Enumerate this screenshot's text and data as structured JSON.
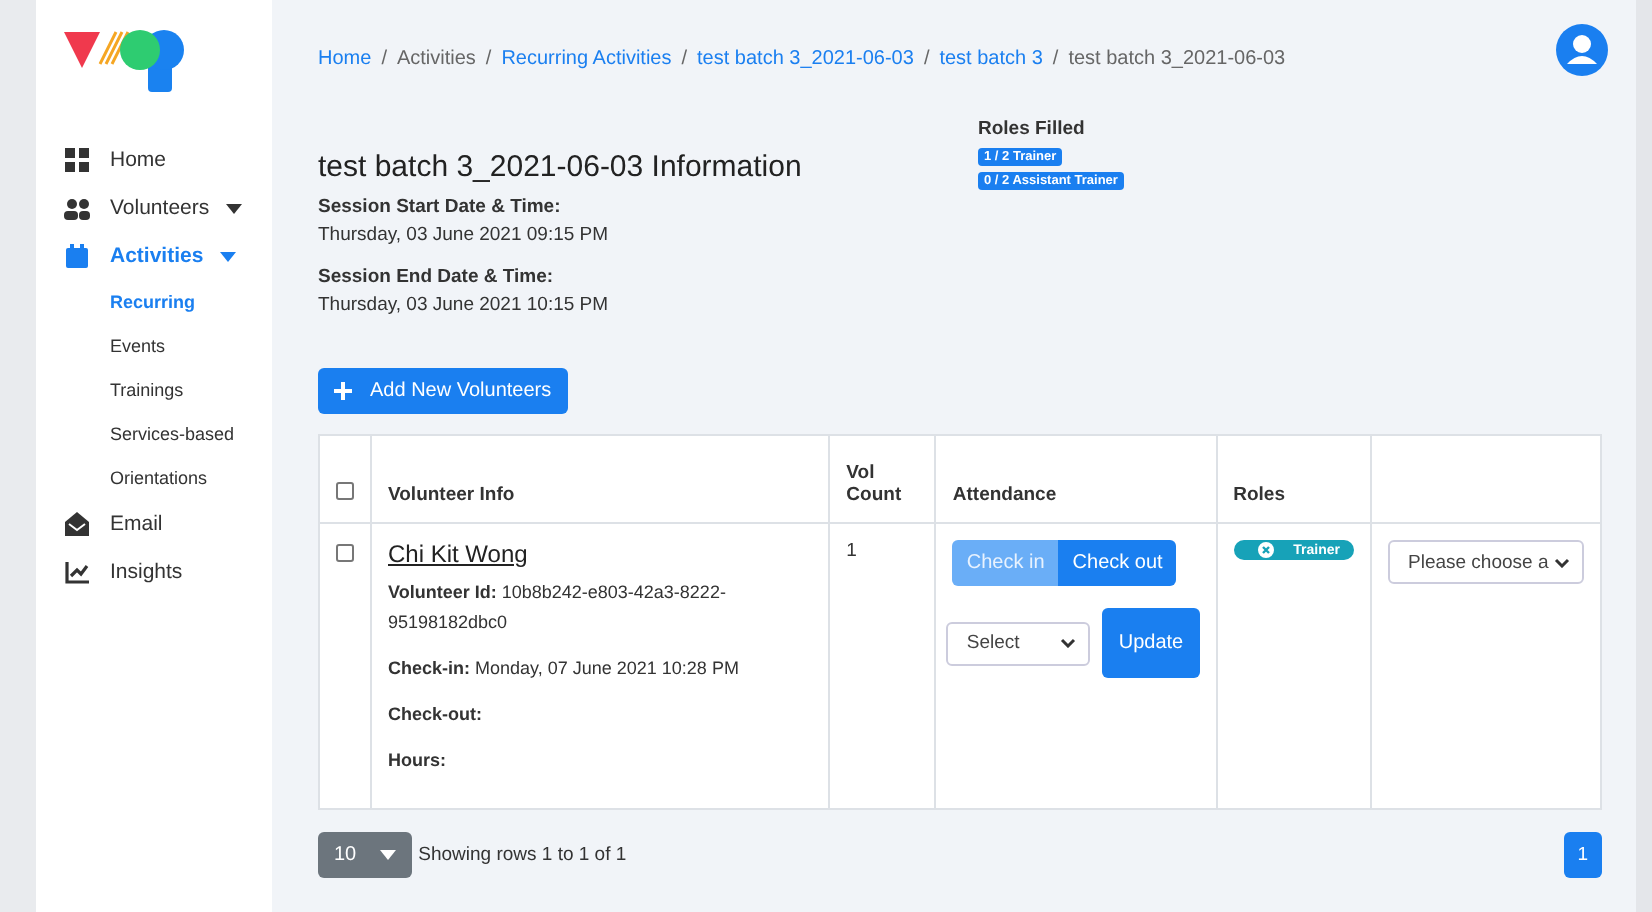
{
  "sidebar": {
    "items": [
      {
        "kind": "item",
        "label": "Home",
        "selected": false,
        "caret": false
      },
      {
        "kind": "item",
        "label": "Volunteers",
        "selected": false,
        "caret": true
      },
      {
        "kind": "item",
        "label": "Activities",
        "selected": true,
        "caret": true
      },
      {
        "kind": "sub",
        "label": "Recurring",
        "selected": true
      },
      {
        "kind": "sub",
        "label": "Events",
        "selected": false
      },
      {
        "kind": "sub",
        "label": "Trainings",
        "selected": false
      },
      {
        "kind": "sub",
        "label": "Services-based",
        "selected": false
      },
      {
        "kind": "sub",
        "label": "Orientations",
        "selected": false
      },
      {
        "kind": "item",
        "label": "Email",
        "selected": false,
        "caret": false
      },
      {
        "kind": "item",
        "label": "Insights",
        "selected": false,
        "caret": false
      }
    ]
  },
  "breadcrumb": [
    {
      "label": "Home",
      "link": true
    },
    {
      "separator": "/",
      "label": "Activities",
      "link": false
    },
    {
      "separator": "/",
      "label": "Recurring Activities",
      "link": true
    },
    {
      "separator": "/",
      "label": "test batch 3_2021-06-03",
      "link": true
    },
    {
      "separator": "/",
      "label": "test batch 3",
      "link": true
    },
    {
      "separator": "/",
      "label": "test batch 3_2021-06-03",
      "link": false
    }
  ],
  "title": "test batch 3_2021-06-03 Information",
  "details": [
    {
      "label": "Session Start Date & Time:",
      "value": "Thursday, 03 June 2021 09:15 PM"
    },
    {
      "label": "Session End Date & Time:",
      "value": "Thursday, 03 June 2021 10:15 PM"
    }
  ],
  "roles_filled": {
    "heading": "Roles Filled",
    "badges": [
      "1 / 2 Trainer",
      "0 / 2 Assistant Trainer"
    ]
  },
  "add_button": "Add New Volunteers",
  "table": {
    "select_all_checked": false,
    "columns": [
      "Volunteer Info",
      "Vol Count",
      "Attendance",
      "Roles"
    ],
    "rows": [
      {
        "checked": false,
        "name": "Chi Kit Wong",
        "fields": [
          {
            "label": "Volunteer Id:",
            "value": "10b8b242-e803-42a3-8222-95198182dbc0"
          },
          {
            "label": "Check-in:",
            "value": "Monday, 07 June 2021 10:28 PM"
          },
          {
            "label": "Check-out:"
          },
          {
            "label": "Hours:"
          }
        ],
        "vol_count": "1",
        "attendance_buttons": [
          {
            "label": "Check in",
            "disabled": true
          },
          {
            "label": "Check out",
            "disabled": false
          }
        ],
        "attendance_select": "Select",
        "update_button": "Update",
        "role": "Trainer",
        "role_select": "Please choose a"
      }
    ]
  },
  "pagination": {
    "page_size": "10",
    "summary": "Showing rows 1 to 1 of 1",
    "pages": [
      {
        "label": "1",
        "selected": true
      }
    ]
  }
}
